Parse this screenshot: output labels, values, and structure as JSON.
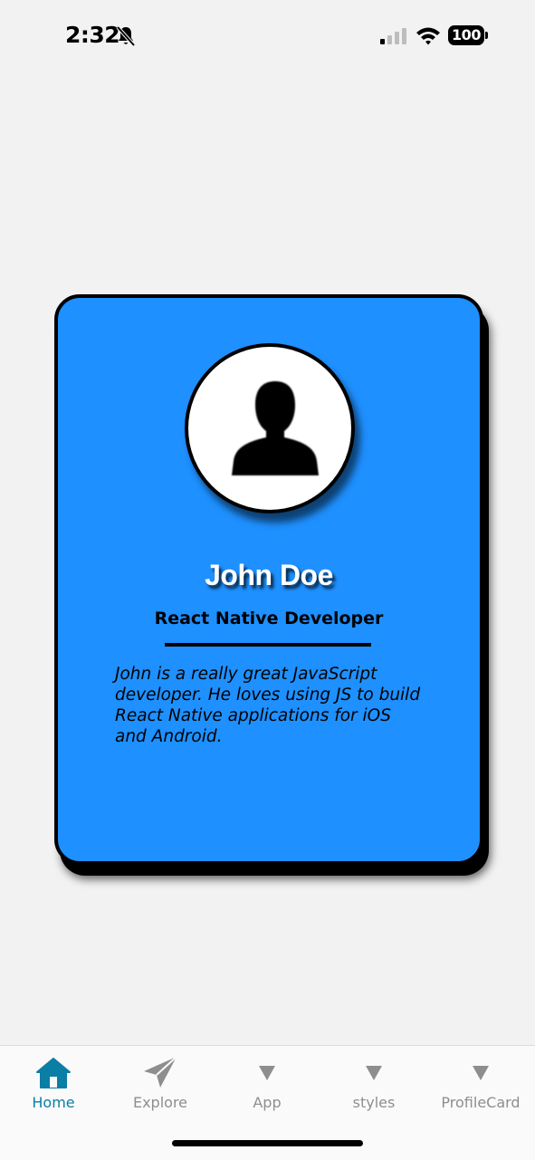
{
  "status_bar": {
    "time": "2:32",
    "battery_level": "100"
  },
  "profile_card": {
    "name": "John Doe",
    "title": "React Native Developer",
    "bio": "John is a really great JavaScript developer. He loves using JS to build React Native applications for iOS and Android."
  },
  "tab_bar": {
    "tabs": [
      {
        "label": "Home",
        "icon": "home-icon",
        "active": true
      },
      {
        "label": "Explore",
        "icon": "paper-plane-icon",
        "active": false
      },
      {
        "label": "App",
        "icon": "triangle-icon",
        "active": false
      },
      {
        "label": "styles",
        "icon": "triangle-icon",
        "active": false
      },
      {
        "label": "ProfileCard",
        "icon": "triangle-icon",
        "active": false
      }
    ]
  },
  "colors": {
    "card_background": "#1e90ff",
    "active_tab": "#0a7ea4",
    "inactive_tab": "#8e8e8e",
    "page_background": "#f2f2f2"
  }
}
